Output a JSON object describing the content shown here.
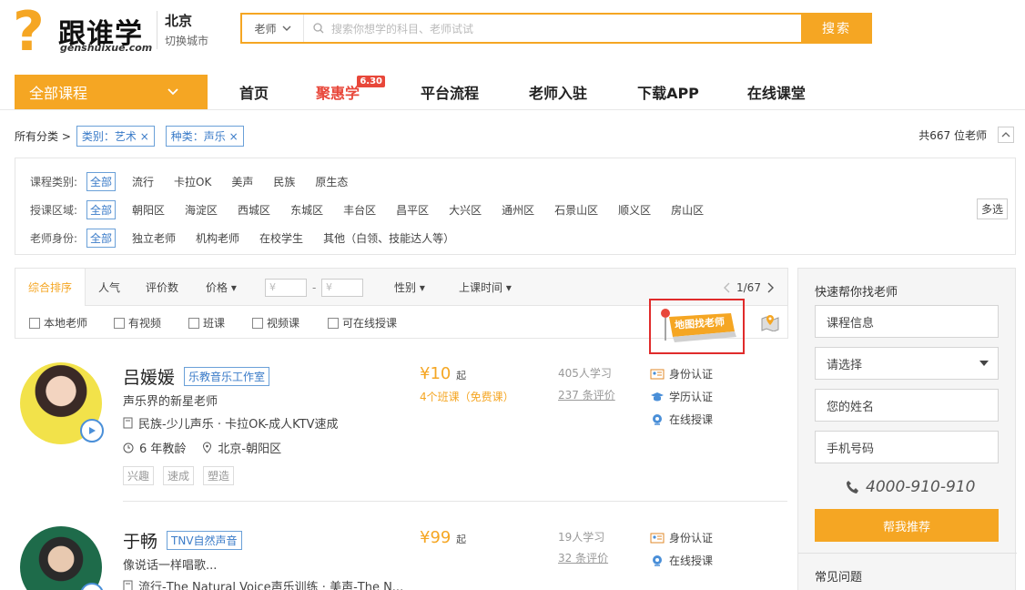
{
  "brand": {
    "logo_symbol": "?",
    "name_cn": "跟谁学",
    "domain": "genshuixue.com",
    "accent": "#f5a623"
  },
  "city": {
    "current": "北京",
    "switch": "切换城市"
  },
  "search": {
    "category": "老师",
    "placeholder": "搜索你想学的科目、老师试试",
    "button": "搜索"
  },
  "nav": {
    "all_courses": "全部课程",
    "items": [
      {
        "label": "首页"
      },
      {
        "label": "聚惠学",
        "badge": "6.30",
        "highlight": "#e8473a"
      },
      {
        "label": "平台流程"
      },
      {
        "label": "老师入驻"
      },
      {
        "label": "下载APP"
      },
      {
        "label": "在线课堂"
      }
    ]
  },
  "breadcrumb": {
    "root": "所有分类 >",
    "tags": [
      "类别：艺术 ×",
      "种类：声乐 ×"
    ]
  },
  "total": "共667 位老师",
  "filters": {
    "multi": "多选",
    "rows": [
      {
        "label": "课程类别:",
        "selected": "全部",
        "options": [
          "流行",
          "卡拉OK",
          "美声",
          "民族",
          "原生态"
        ]
      },
      {
        "label": "授课区域:",
        "selected": "全部",
        "options": [
          "朝阳区",
          "海淀区",
          "西城区",
          "东城区",
          "丰台区",
          "昌平区",
          "大兴区",
          "通州区",
          "石景山区",
          "顺义区",
          "房山区"
        ]
      },
      {
        "label": "老师身份:",
        "selected": "全部",
        "options": [
          "独立老师",
          "机构老师",
          "在校学生",
          "其他（白领、技能达人等）"
        ]
      }
    ]
  },
  "sort": {
    "active": "综合排序",
    "items": [
      "人气",
      "评价数",
      "价格 ▾"
    ],
    "price_placeholder": "¥",
    "dash": "-",
    "gender": "性别 ▾",
    "time": "上课时间 ▾",
    "page": "1/67"
  },
  "checks": [
    "本地老师",
    "有视频",
    "班课",
    "视频课",
    "可在线授课"
  ],
  "map_search": "地图找老师",
  "teachers": [
    {
      "name": "吕媛媛",
      "org": "乐教音乐工作室",
      "slogan": "声乐界的新星老师",
      "subjects": "民族-少儿声乐 · 卡拉OK-成人KTV速成",
      "years": "6 年教龄",
      "location": "北京-朝阳区",
      "tags": [
        "兴趣",
        "速成",
        "塑造"
      ],
      "price": "¥10",
      "price_suffix": "起",
      "classes": "4个班课",
      "free": "（免费课）",
      "students": "405人学习",
      "reviews": "237 条评价",
      "certs": [
        "身份认证",
        "学历认证",
        "在线授课"
      ]
    },
    {
      "name": "于畅",
      "org": "TNV自然声音",
      "slogan": "像说话一样唱歌...",
      "subjects": "流行-The Natural Voice声乐训练 · 美声-The N...",
      "price": "¥99",
      "price_suffix": "起",
      "students": "19人学习",
      "reviews": "32 条评价",
      "certs": [
        "身份认证",
        "在线授课"
      ]
    }
  ],
  "panel": {
    "title": "快速帮你找老师",
    "course_info": "课程信息",
    "select": "请选择",
    "name": "您的姓名",
    "phone": "手机号码",
    "hotline": "4000-910-910",
    "submit": "帮我推荐",
    "faq": "常见问题"
  }
}
